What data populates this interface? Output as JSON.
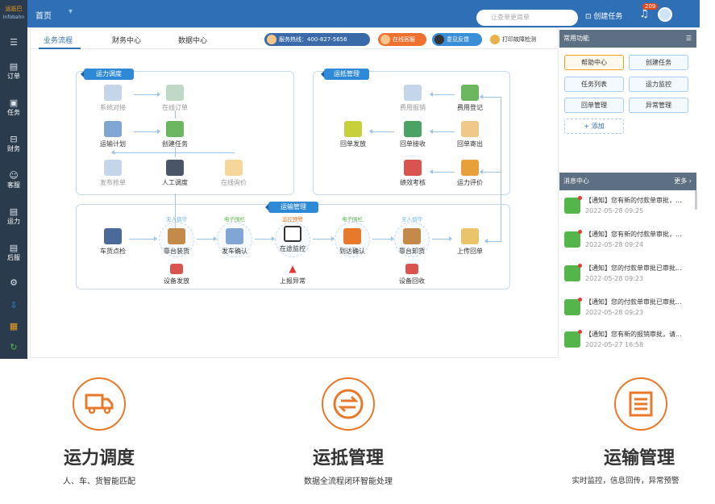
{
  "header": {
    "logo": "运抵巴",
    "logo_sub": "Infobahn",
    "home": "首页",
    "search_placeholder": "让查单更简单",
    "create_task": "创建任务",
    "badge": "209"
  },
  "sidebar": {
    "items": [
      {
        "label": "",
        "icon": "menu-icon"
      },
      {
        "label": "订单",
        "icon": "order-icon"
      },
      {
        "label": "任务",
        "icon": "task-icon"
      },
      {
        "label": "财务",
        "icon": "finance-icon"
      },
      {
        "label": "客服",
        "icon": "service-icon"
      },
      {
        "label": "运力",
        "icon": "capacity-icon"
      },
      {
        "label": "后服",
        "icon": "after-service-icon"
      },
      {
        "label": "",
        "icon": "gear-icon"
      }
    ]
  },
  "tabs": {
    "business": "业务流程",
    "finance": "财务中心",
    "data": "数据中心"
  },
  "pills": {
    "hotline": "服务热线：400-827-5656",
    "online": "在线客服",
    "feedback": "意见反馈",
    "print": "打印故障检测"
  },
  "capacity": {
    "title": "运力调度",
    "system_match": "系统对接",
    "online_order": "在线订单",
    "transport_plan": "运输计划",
    "create_task": "创建任务",
    "publish_bid": "发布抢单",
    "manual_dispatch": "人工调度",
    "online_inquiry": "在线询价"
  },
  "arrival": {
    "title": "运抵管理",
    "expense_report": "费用报销",
    "expense_register": "费用登记",
    "receipt_send": "回单发放",
    "receipt_receive": "回单接收",
    "receipt_mail": "回单寄出",
    "performance": "绩效考核",
    "capacity_eval": "运力评价"
  },
  "transport": {
    "title": "运输管理",
    "unmanned1": "无人值守",
    "efence1": "电子围栏",
    "monitor": "监控预警",
    "efence2": "电子围栏",
    "unmanned2": "无人值守",
    "vehicle_check": "车货点检",
    "dock_load": "靠台装货",
    "depart_confirm": "发车确认",
    "in_transit": "在途监控",
    "arrive_confirm": "到达确认",
    "dock_unload": "靠台卸货",
    "upload_receipt": "上传回单",
    "device_issue": "设备发放",
    "report_exception": "上报异常",
    "device_recover": "设备回收"
  },
  "quick": {
    "title": "常用功能",
    "items": [
      "帮助中心",
      "创建任务",
      "任务列表",
      "运力监控",
      "回单管理",
      "异常管理"
    ],
    "add": "+ 添加"
  },
  "messages": {
    "title": "消息中心",
    "more": "更多",
    "items": [
      {
        "text": "【通知】您有新的付款单审批，...",
        "date": "2022-05-28 09:25"
      },
      {
        "text": "【通知】您有新的付款单审批，...",
        "date": "2022-05-28 09:24"
      },
      {
        "text": "【通知】您的付款单审批已审批...",
        "date": "2022-05-28 09:23"
      },
      {
        "text": "【通知】您的付款单审批已审批...",
        "date": "2022-05-28 09:23"
      },
      {
        "text": "【通知】您有新的报销审批，请...",
        "date": "2022-05-27 16:58"
      }
    ]
  },
  "features": [
    {
      "title": "运力调度",
      "sub": "人、车、货智能匹配"
    },
    {
      "title": "运抵管理",
      "sub": "数据全流程闭环智能处理"
    },
    {
      "title": "运输管理",
      "sub": "实时监控，信息回传，异常预警"
    }
  ]
}
